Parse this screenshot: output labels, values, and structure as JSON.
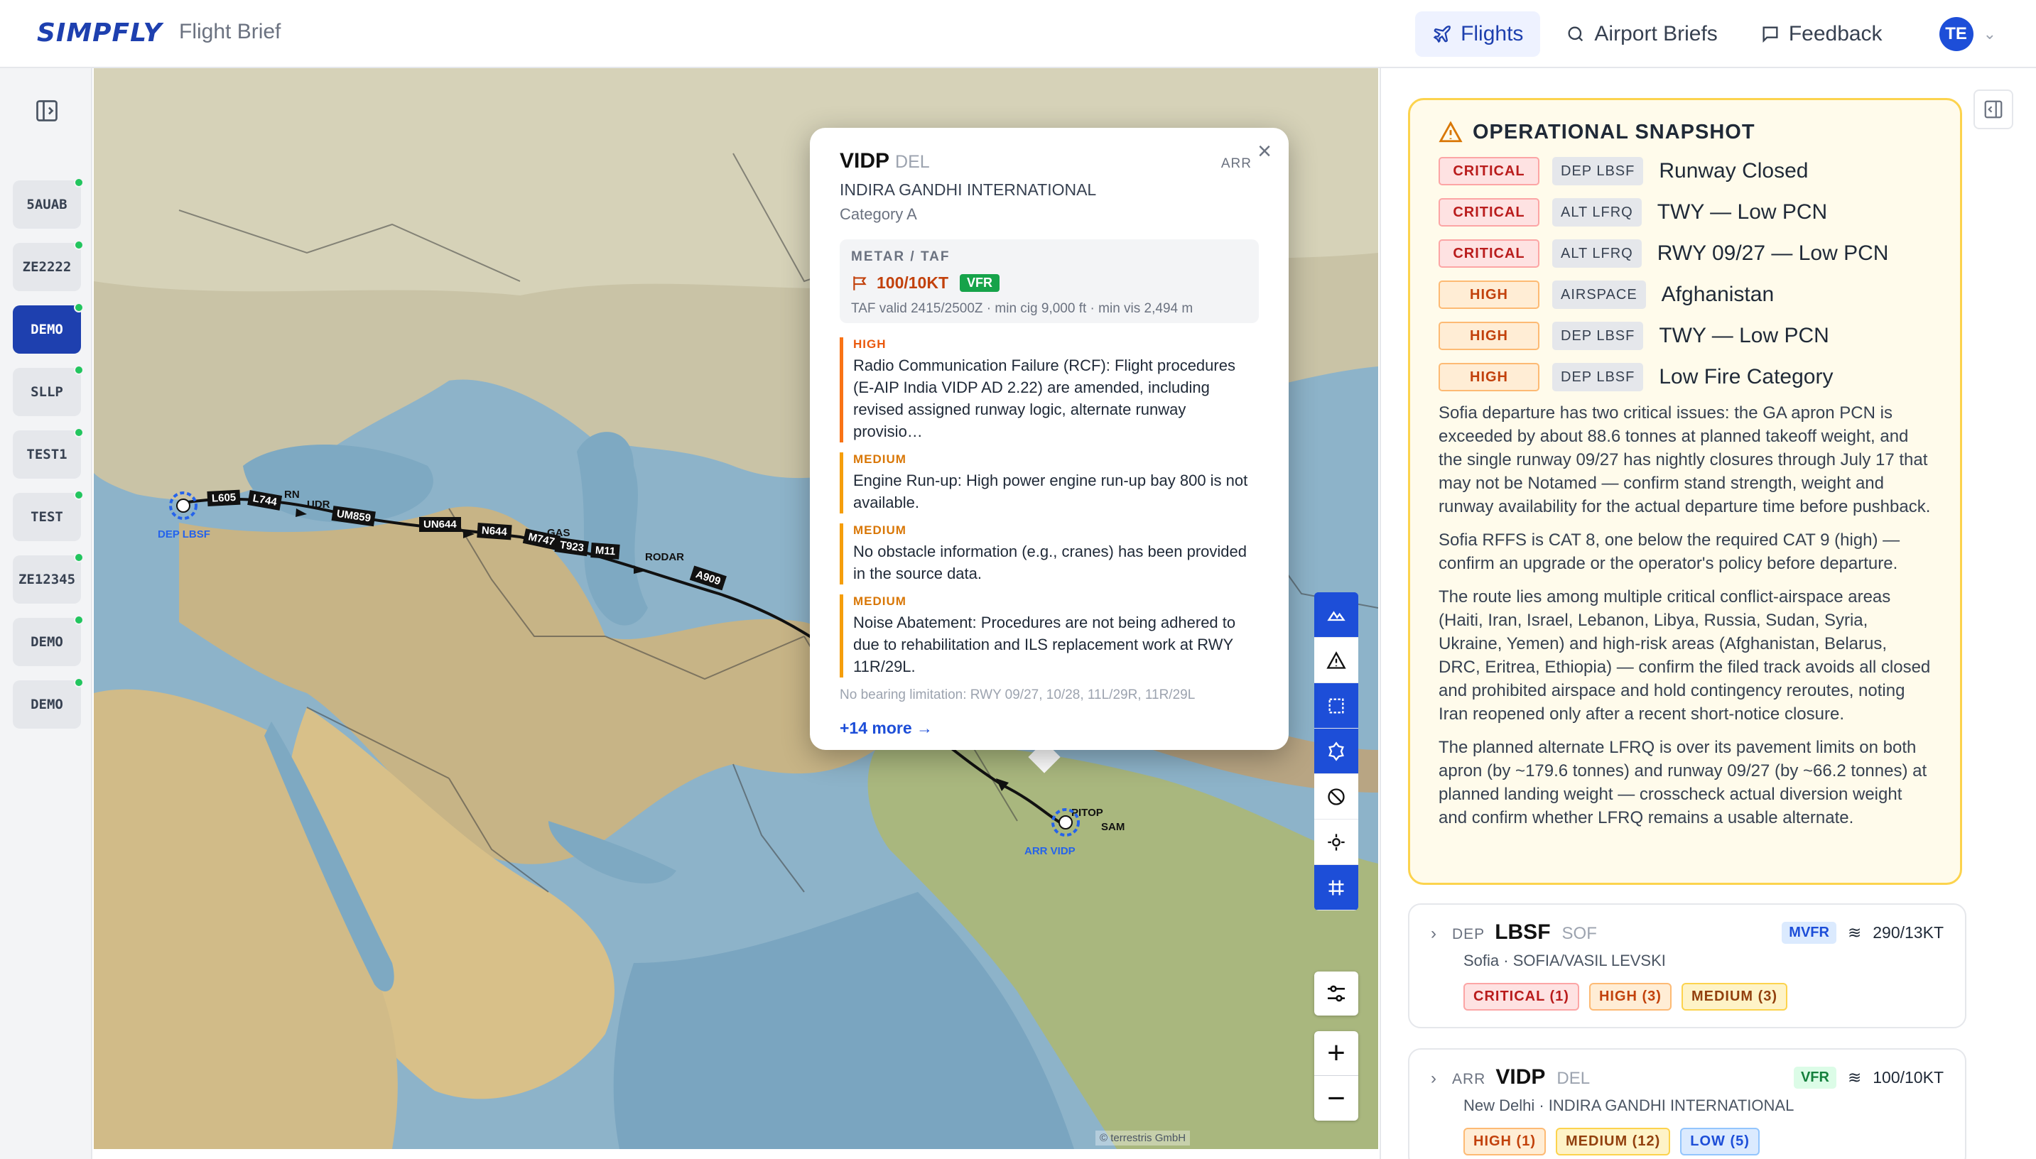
{
  "header": {
    "logo": "SIMPFLY",
    "app_title": "Flight Brief",
    "nav": [
      {
        "label": "Flights",
        "icon": "plane-icon",
        "active": true
      },
      {
        "label": "Airport Briefs",
        "icon": "search-icon",
        "active": false
      },
      {
        "label": "Feedback",
        "icon": "message-icon",
        "active": false
      }
    ],
    "avatar_initials": "TE"
  },
  "sidebar": {
    "flights": [
      {
        "label": "5AUAB",
        "active": false
      },
      {
        "label": "ZE2222",
        "active": false
      },
      {
        "label": "DEMO",
        "active": true
      },
      {
        "label": "SLLP",
        "active": false
      },
      {
        "label": "TEST1",
        "active": false
      },
      {
        "label": "TEST",
        "active": false
      },
      {
        "label": "ZE12345",
        "active": false
      },
      {
        "label": "DEMO",
        "active": false
      },
      {
        "label": "DEMO",
        "active": false
      }
    ]
  },
  "map": {
    "route_labels": [
      "L605",
      "L744",
      "UM859",
      "UN644",
      "N644",
      "M747",
      "T923",
      "M11",
      "A909"
    ],
    "plain_labels": [
      "RN",
      "UDR",
      "GAS",
      "RODAR",
      "PITOP",
      "SAM"
    ],
    "dep_label": "DEP LBSF",
    "arr_label": "ARR VIDP",
    "attribution": "© terrestris GmbH",
    "tools": [
      "terrain-icon",
      "warning-icon",
      "select-box-icon",
      "gear-outline-icon",
      "no-entry-icon",
      "locate-icon",
      "grid-icon"
    ]
  },
  "popup": {
    "code": "VIDP",
    "iata": "DEL",
    "role": "ARR",
    "name": "INDIRA GANDHI INTERNATIONAL",
    "category": "Category A",
    "metar_label": "METAR / TAF",
    "wind": "100/10KT",
    "flight_rules": "VFR",
    "taf_valid": "TAF valid 2415/2500Z · min cig 9,000 ft · min vis 2,494 m",
    "notams": [
      {
        "severity": "HIGH",
        "text": "Radio Communication Failure (RCF): Flight procedures (E-AIP India VIDP AD 2.22) are amended, including revised assigned runway logic, alternate runway provisio…"
      },
      {
        "severity": "MEDIUM",
        "text": "Engine Run-up: High power engine run-up bay 800 is not available."
      },
      {
        "severity": "MEDIUM",
        "text": "No obstacle information (e.g., cranes) has been provided in the source data."
      },
      {
        "severity": "MEDIUM",
        "text": "Noise Abatement: Procedures are not being adhered to due to rehabilitation and ILS replacement work at RWY 11R/29L."
      }
    ],
    "bearing_note": "No bearing limitation: RWY 09/27, 10/28, 11L/29R, 11R/29L",
    "more_link": "+14 more →"
  },
  "snapshot": {
    "title": "OPERATIONAL SNAPSHOT",
    "issues": [
      {
        "severity": "CRITICAL",
        "scope": "DEP LBSF",
        "text": "Runway Closed"
      },
      {
        "severity": "CRITICAL",
        "scope": "ALT LFRQ",
        "text": "TWY — Low PCN"
      },
      {
        "severity": "CRITICAL",
        "scope": "ALT LFRQ",
        "text": "RWY 09/27 — Low PCN"
      },
      {
        "severity": "HIGH",
        "scope": "AIRSPACE",
        "text": "Afghanistan"
      },
      {
        "severity": "HIGH",
        "scope": "DEP LBSF",
        "text": "TWY — Low PCN"
      },
      {
        "severity": "HIGH",
        "scope": "DEP LBSF",
        "text": "Low Fire Category"
      }
    ],
    "paragraphs": [
      "Sofia departure has two critical issues: the GA apron PCN is exceeded by about 88.6 tonnes at planned takeoff weight, and the single runway 09/27 has nightly closures through July 17 that may not be Notamed — confirm stand strength, weight and runway availability for the actual departure time before pushback.",
      "Sofia RFFS is CAT 8, one below the required CAT 9 (high) — confirm an upgrade or the operator's policy before departure.",
      "The route lies among multiple critical conflict-airspace areas (Haiti, Iran, Israel, Lebanon, Libya, Russia, Sudan, Syria, Ukraine, Yemen) and high-risk areas (Afghanistan, Belarus, DRC, Eritrea, Ethiopia) — confirm the filed track avoids all closed and prohibited airspace and hold contingency reroutes, noting Iran reopened only after a recent short-notice closure.",
      "The planned alternate LFRQ is over its pavement limits on both apron (by ~179.6 tonnes) and runway 09/27 (by ~66.2 tonnes) at planned landing weight — crosscheck actual diversion weight and confirm whether LFRQ remains a usable alternate."
    ]
  },
  "airports": [
    {
      "role": "DEP",
      "code": "LBSF",
      "iata": "SOF",
      "location": "Sofia · SOFIA/VASIL LEVSKI",
      "flight_rules": "MVFR",
      "wind": "290/13KT",
      "counts": [
        {
          "label": "CRITICAL (1)",
          "level": "critical"
        },
        {
          "label": "HIGH (3)",
          "level": "high"
        },
        {
          "label": "MEDIUM (3)",
          "level": "medium"
        }
      ]
    },
    {
      "role": "ARR",
      "code": "VIDP",
      "iata": "DEL",
      "location": "New Delhi · INDIRA GANDHI INTERNATIONAL",
      "flight_rules": "VFR",
      "wind": "100/10KT",
      "counts": [
        {
          "label": "HIGH (1)",
          "level": "high"
        },
        {
          "label": "MEDIUM (12)",
          "level": "medium"
        },
        {
          "label": "LOW (5)",
          "level": "low"
        }
      ]
    }
  ],
  "colors": {
    "brand": "#1e40af",
    "critical": "#b91c1c",
    "high": "#c2410c",
    "medium": "#d97706"
  }
}
